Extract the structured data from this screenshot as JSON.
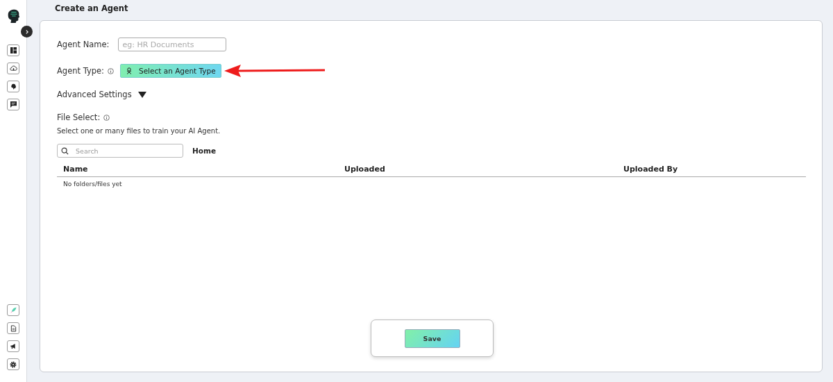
{
  "page_title": "Create an Agent",
  "form": {
    "agent_name": {
      "label": "Agent Name:",
      "placeholder": "eg: HR Documents"
    },
    "agent_type": {
      "label": "Agent Type:",
      "button": "Select an Agent Type"
    },
    "advanced_settings": {
      "label": "Advanced Settings",
      "expanded": false
    },
    "file_select": {
      "label": "File Select:",
      "description": "Select one or many files to train your AI Agent."
    }
  },
  "file_browser": {
    "search": {
      "placeholder": "Search"
    },
    "breadcrumb": "Home",
    "table": {
      "columns": [
        "Name",
        "Uploaded",
        "Uploaded By"
      ],
      "empty_message": "No folders/files yet"
    }
  },
  "save_button": "Save"
}
